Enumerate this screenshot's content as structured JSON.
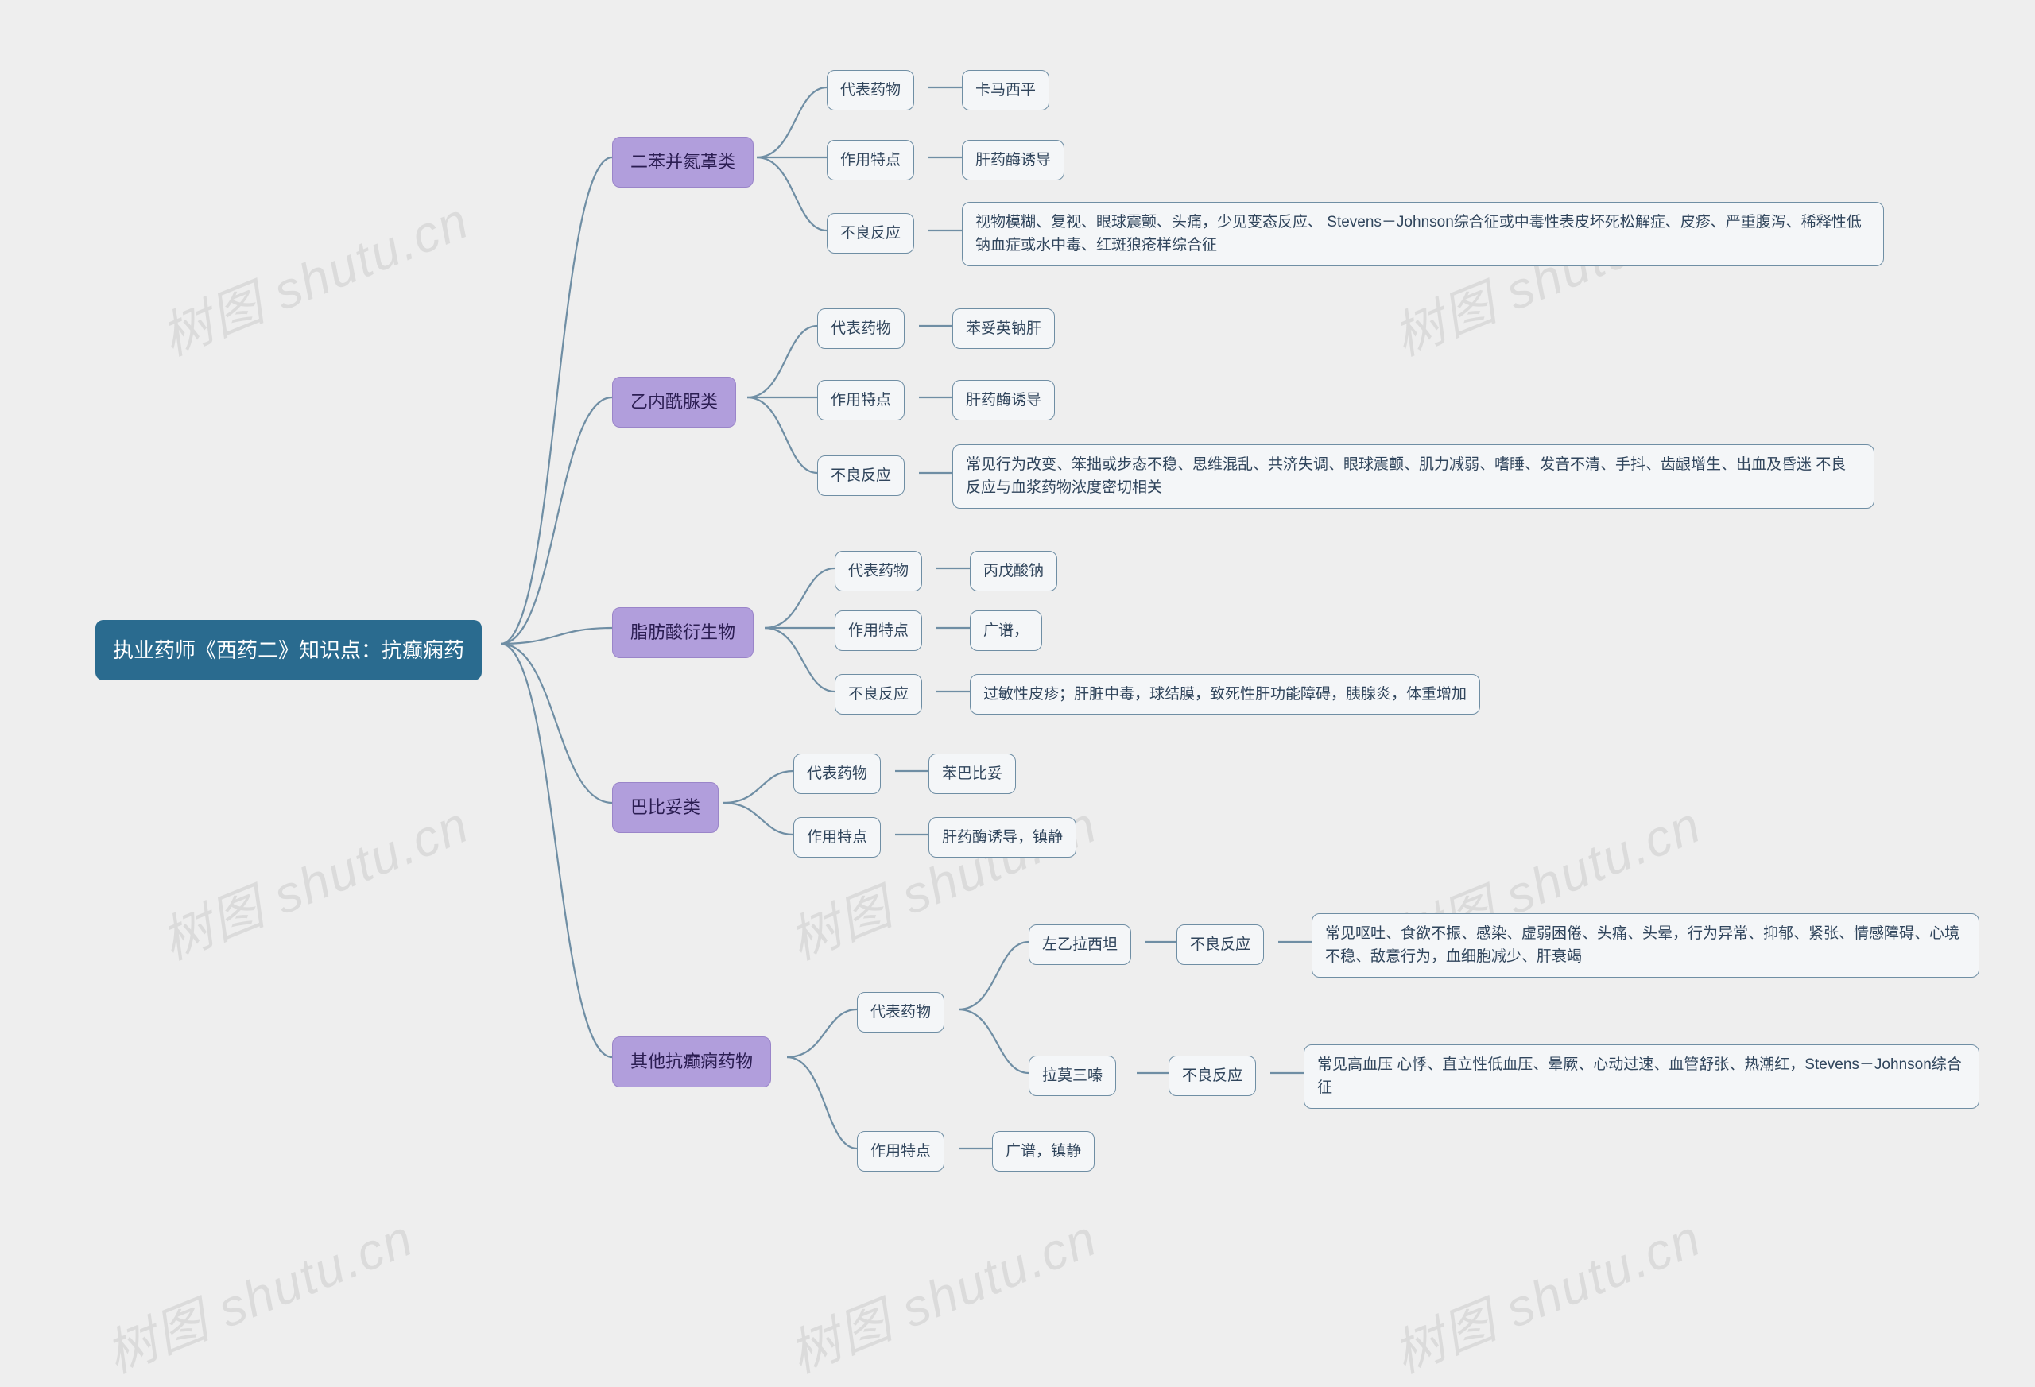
{
  "watermark": "树图 shutu.cn",
  "root": "执业药师《西药二》知识点：抗癫痫药",
  "labels": {
    "rep_drug": "代表药物",
    "feature": "作用特点",
    "adverse": "不良反应"
  },
  "categories": [
    {
      "name": "二苯并氮䓬类",
      "rep_drug": "卡马西平",
      "feature": "肝药酶诱导",
      "adverse": "视物模糊、复视、眼球震颤、头痛，少见变态反应、 Stevens－Johnson综合征或中毒性表皮坏死松解症、皮疹、严重腹泻、稀释性低钠血症或水中毒、红斑狼疮样综合征"
    },
    {
      "name": "乙内酰脲类",
      "rep_drug": "苯妥英钠肝",
      "feature": "肝药酶诱导",
      "adverse": "常见行为改变、笨拙或步态不稳、思维混乱、共济失调、眼球震颤、肌力减弱、嗜睡、发音不清、手抖、齿龈增生、出血及昏迷 不良反应与血浆药物浓度密切相关"
    },
    {
      "name": "脂肪酸衍生物",
      "rep_drug": "丙戊酸钠",
      "feature": "广谱，",
      "adverse": "过敏性皮疹；肝脏中毒，球结膜，致死性肝功能障碍，胰腺炎，体重增加"
    },
    {
      "name": "巴比妥类",
      "rep_drug": "苯巴比妥",
      "feature": "肝药酶诱导，镇静"
    },
    {
      "name": "其他抗癫痫药物",
      "feature": "广谱，镇静",
      "drugs": [
        {
          "name": "左乙拉西坦",
          "adverse": "常见呕吐、食欲不振、感染、虚弱困倦、头痛、头晕，行为异常、抑郁、紧张、情感障碍、心境不稳、敌意行为，血细胞减少、肝衰竭"
        },
        {
          "name": "拉莫三嗪",
          "adverse": "常见高血压 心悸、直立性低血压、晕厥、心动过速、血管舒张、热潮红，Stevens－Johnson综合征"
        }
      ]
    }
  ]
}
